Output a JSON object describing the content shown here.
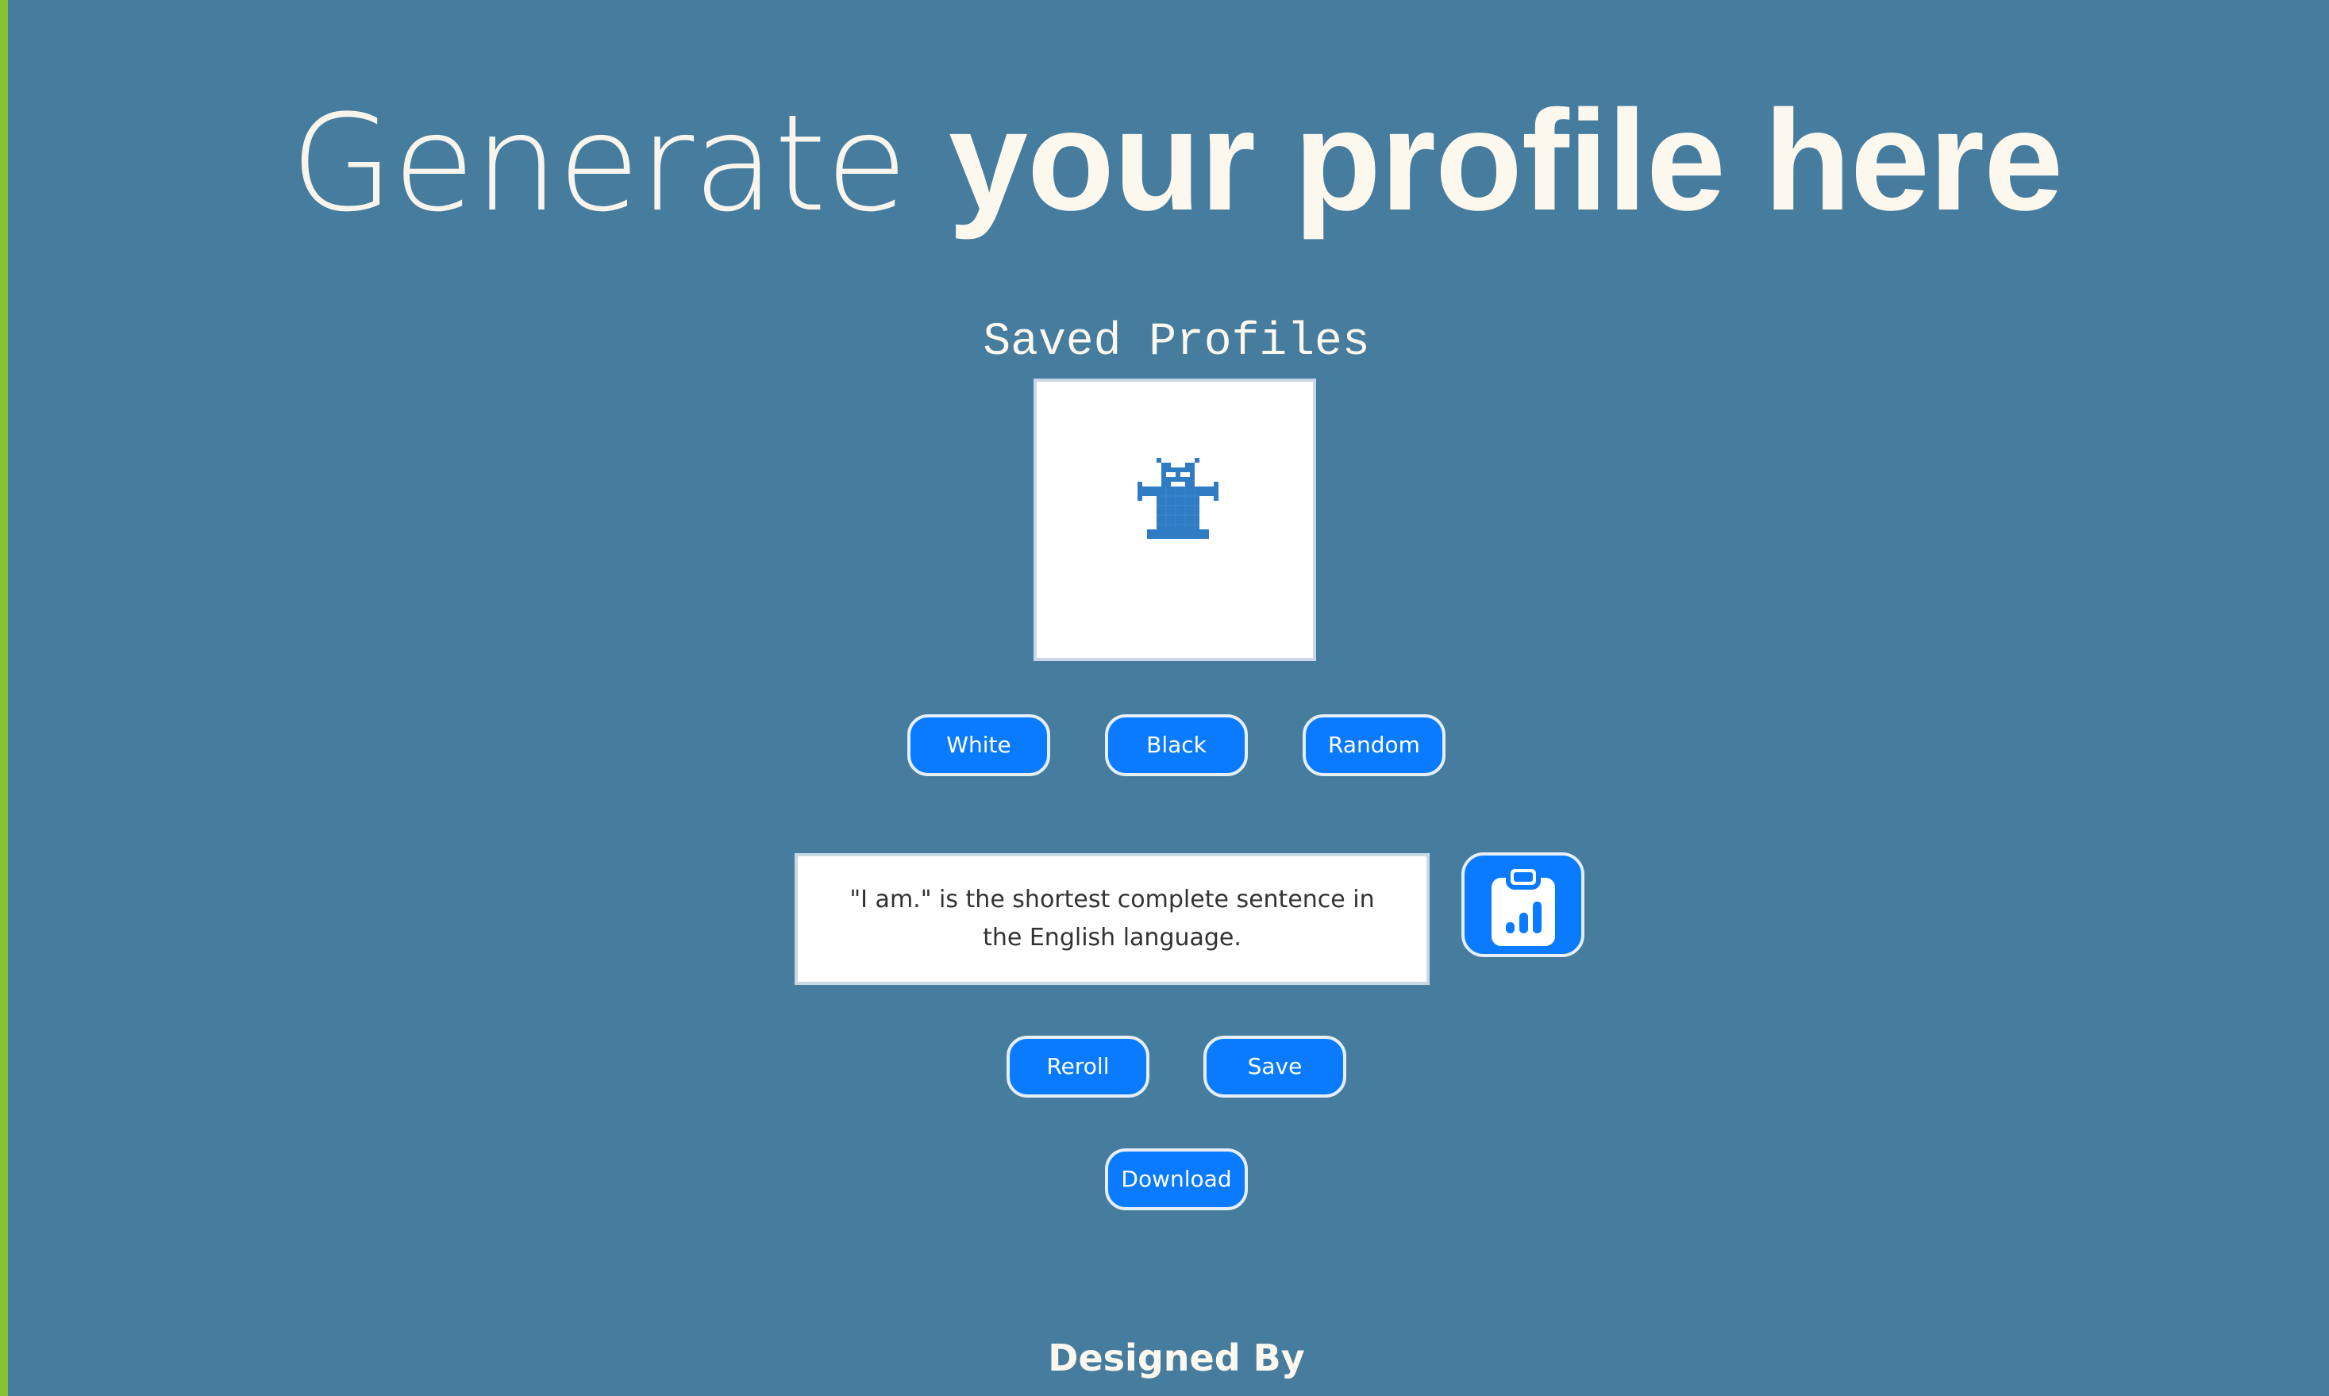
{
  "header": {
    "title_light": "Generate",
    "title_bold": "your profile here"
  },
  "saved_profiles": {
    "title": "Saved Profiles",
    "avatar_icon": "pixel-monster-icon"
  },
  "color_buttons": {
    "white": "White",
    "black": "Black",
    "random": "Random"
  },
  "quote": {
    "text": "\"I am.\" is the shortest complete sentence in the English language."
  },
  "clipboard": {
    "icon": "clipboard-chart-icon"
  },
  "actions": {
    "reroll": "Reroll",
    "save": "Save",
    "download": "Download"
  },
  "footer": {
    "title": "Designed By"
  },
  "colors": {
    "background": "#467c9e",
    "accent_bar": "#86c232",
    "button": "#0a7bff",
    "text_light": "#fdf8ee",
    "avatar": "#2f7cc4"
  }
}
